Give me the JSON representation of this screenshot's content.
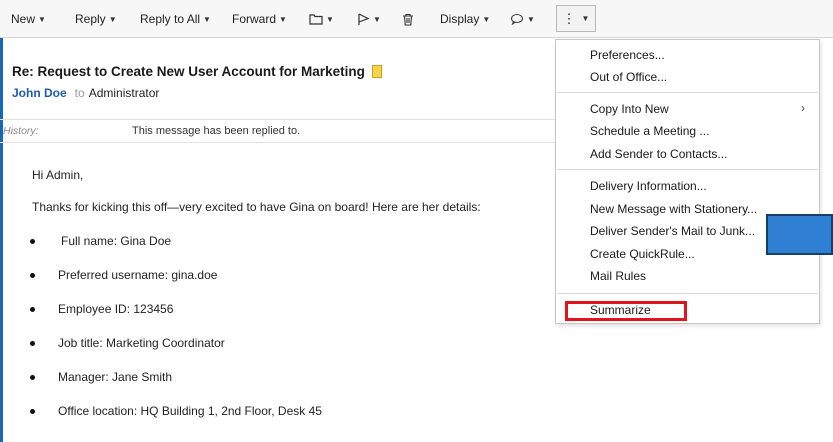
{
  "toolbar": {
    "new": "New",
    "reply": "Reply",
    "reply_to_all": "Reply to All",
    "forward": "Forward",
    "display": "Display",
    "more": "⋮"
  },
  "message": {
    "subject": "Re: Request to Create New User Account for Marketing",
    "sender": "John Doe",
    "to_label": "to",
    "recipient": "Administrator",
    "history_label": "History:",
    "history_text": "This message has been replied to.",
    "greeting": "Hi Admin,",
    "intro": "Thanks for kicking this off—very excited to have Gina on board! Here are her details:",
    "details": [
      "Full name: Gina Doe",
      "Preferred username: gina.doe",
      "Employee ID: 123456",
      "Job title: Marketing Coordinator",
      "Manager: Jane Smith",
      "Office location: HQ Building 1, 2nd Floor, Desk 45"
    ]
  },
  "menu": {
    "items": [
      "Preferences...",
      "Out of Office...",
      "Copy Into New",
      "Schedule a Meeting ...",
      "Add Sender to Contacts...",
      "Delivery Information...",
      "New Message with Stationery...",
      "Deliver Sender's Mail to Junk...",
      "Create QuickRule...",
      "Mail Rules",
      "Summarize"
    ],
    "submenu_arrow": "›",
    "highlight_color": "#e0141a"
  }
}
